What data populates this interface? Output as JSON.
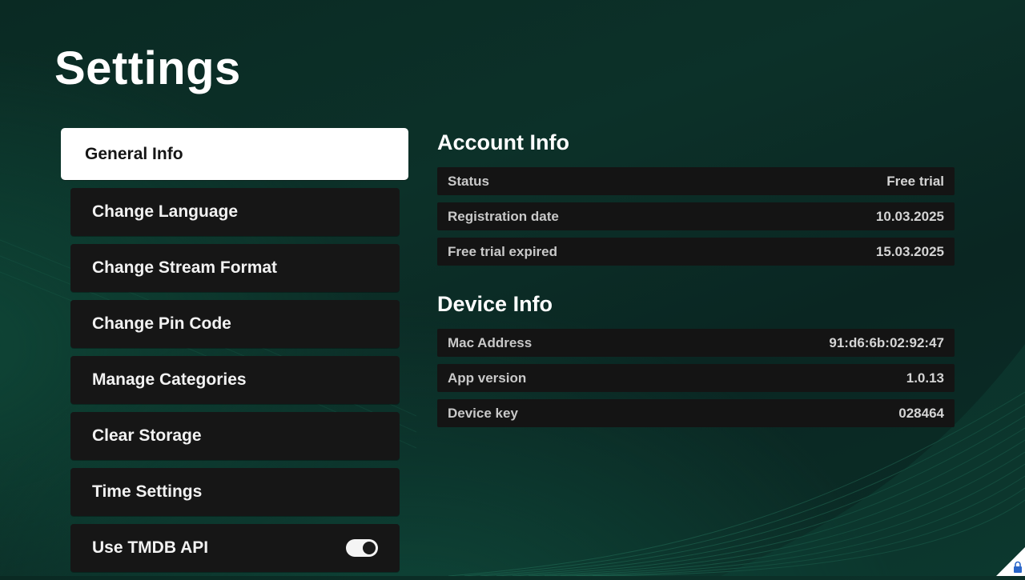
{
  "page": {
    "title": "Settings"
  },
  "menu": {
    "items": [
      {
        "label": "General Info",
        "active": true
      },
      {
        "label": "Change Language",
        "active": false
      },
      {
        "label": "Change Stream Format",
        "active": false
      },
      {
        "label": "Change Pin Code",
        "active": false
      },
      {
        "label": "Manage Categories",
        "active": false
      },
      {
        "label": "Clear Storage",
        "active": false
      },
      {
        "label": "Time Settings",
        "active": false
      },
      {
        "label": "Use TMDB API",
        "active": false,
        "toggle_on": true
      }
    ]
  },
  "account_info": {
    "title": "Account Info",
    "rows": [
      {
        "label": "Status",
        "value": "Free trial"
      },
      {
        "label": "Registration date",
        "value": "10.03.2025"
      },
      {
        "label": "Free trial expired",
        "value": "15.03.2025"
      }
    ]
  },
  "device_info": {
    "title": "Device Info",
    "rows": [
      {
        "label": "Mac Address",
        "value": "91:d6:6b:02:92:47"
      },
      {
        "label": "App version",
        "value": "1.0.13"
      },
      {
        "label": "Device key",
        "value": "028464"
      }
    ]
  },
  "colors": {
    "background": "#0b2e27",
    "menu_item_bg": "#161616",
    "menu_item_active_bg": "#ffffff",
    "info_row_bg": "#141414"
  },
  "icons": {
    "toggle": "toggle-switch-on",
    "corner_badge": "lock-icon"
  }
}
